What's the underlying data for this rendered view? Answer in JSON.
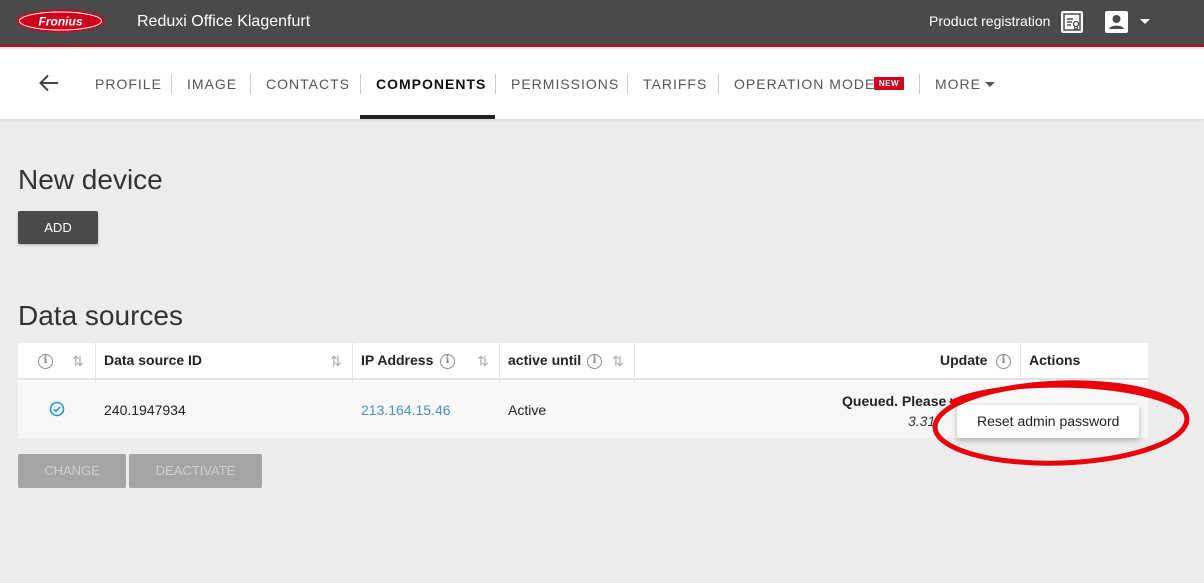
{
  "header": {
    "logo_text": "Fronius",
    "app_title": "Reduxi Office Klagenfurt",
    "product_registration": "Product registration",
    "brand_color": "#d0021b"
  },
  "tabs": [
    {
      "label": "PROFILE"
    },
    {
      "label": "IMAGE"
    },
    {
      "label": "CONTACTS"
    },
    {
      "label": "COMPONENTS",
      "active": true
    },
    {
      "label": "PERMISSIONS"
    },
    {
      "label": "TARIFFS"
    },
    {
      "label": "OPERATION MODE",
      "badge": "NEW"
    },
    {
      "label": "MORE"
    }
  ],
  "new_device": {
    "title": "New device",
    "add_label": "ADD"
  },
  "data_sources": {
    "title": "Data sources",
    "columns": {
      "data_source_id": "Data source ID",
      "ip_address": "IP Address",
      "active_until": "active until",
      "update": "Update",
      "actions": "Actions"
    },
    "rows": [
      {
        "data_source_id": "240.1947934",
        "ip_address": "213.164.15.46",
        "active_until": "Active",
        "update_status": "Queued. Please w",
        "update_version": "3.31"
      }
    ],
    "change_label": "CHANGE",
    "deactivate_label": "DEACTIVATE"
  },
  "actions_menu": {
    "reset_admin_password": "Reset admin password"
  },
  "annotation_color": "#e8000b"
}
